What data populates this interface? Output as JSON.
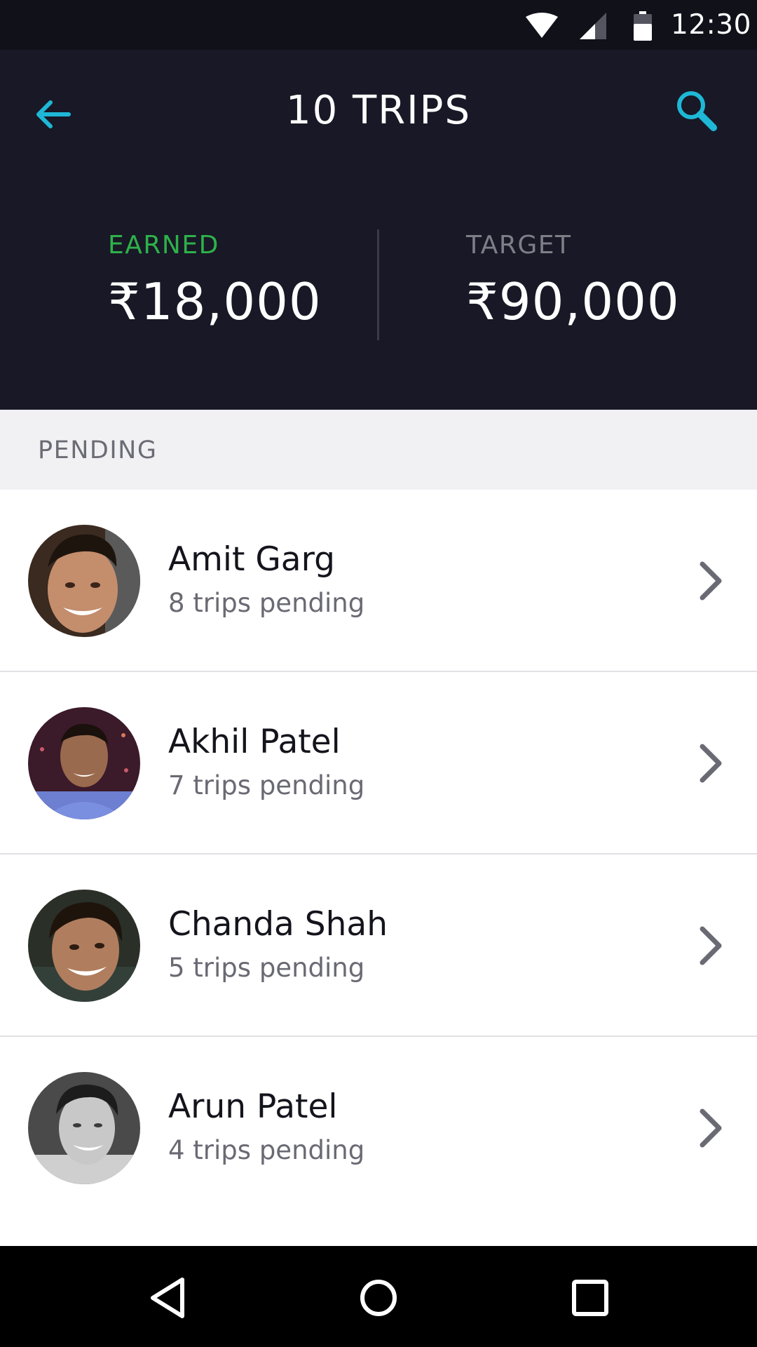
{
  "status_bar": {
    "time": "12:30"
  },
  "header": {
    "title": "10 TRIPS",
    "earned_label": "EARNED",
    "earned_value": "₹18,000",
    "target_label": "TARGET",
    "target_value": "₹90,000"
  },
  "section": {
    "title": "PENDING"
  },
  "people": [
    {
      "name": "Amit Garg",
      "trips": "8 trips pending"
    },
    {
      "name": "Akhil Patel",
      "trips": "7 trips pending"
    },
    {
      "name": "Chanda Shah",
      "trips": "5 trips pending"
    },
    {
      "name": "Arun Patel",
      "trips": "4 trips pending"
    }
  ],
  "colors": {
    "header_bg": "#181826",
    "accent": "#1fb7d6",
    "earned": "#2eb14a"
  },
  "icons": [
    "wifi-icon",
    "cell-signal-icon",
    "battery-icon",
    "back-arrow-icon",
    "search-icon",
    "chevron-right-icon",
    "nav-back-icon",
    "nav-home-icon",
    "nav-recents-icon"
  ]
}
